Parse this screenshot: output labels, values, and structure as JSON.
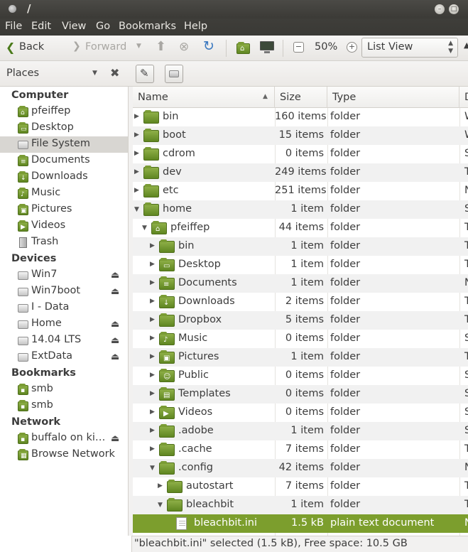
{
  "window": {
    "title": "/"
  },
  "menu": [
    "File",
    "Edit",
    "View",
    "Go",
    "Bookmarks",
    "Help"
  ],
  "toolbar": {
    "back": "Back",
    "forward": "Forward",
    "zoom": "50%",
    "view_mode": "List View"
  },
  "sidebar": {
    "header": "Places",
    "groups": [
      {
        "label": "Computer",
        "items": [
          {
            "label": "pfeiffep",
            "icon": "home-folder-icon"
          },
          {
            "label": "Desktop",
            "icon": "desktop-icon"
          },
          {
            "label": "File System",
            "icon": "drive-icon",
            "selected": true
          },
          {
            "label": "Documents",
            "icon": "documents-icon"
          },
          {
            "label": "Downloads",
            "icon": "downloads-icon"
          },
          {
            "label": "Music",
            "icon": "music-icon"
          },
          {
            "label": "Pictures",
            "icon": "pictures-icon"
          },
          {
            "label": "Videos",
            "icon": "videos-icon"
          },
          {
            "label": "Trash",
            "icon": "trash-icon"
          }
        ]
      },
      {
        "label": "Devices",
        "items": [
          {
            "label": "Win7",
            "icon": "drive-icon",
            "eject": true
          },
          {
            "label": "Win7boot",
            "icon": "drive-icon",
            "eject": true
          },
          {
            "label": "I - Data",
            "icon": "drive-icon"
          },
          {
            "label": "Home",
            "icon": "drive-icon",
            "eject": true
          },
          {
            "label": "14.04 LTS",
            "icon": "drive-icon",
            "eject": true
          },
          {
            "label": "ExtData",
            "icon": "drive-icon",
            "eject": true
          }
        ]
      },
      {
        "label": "Bookmarks",
        "items": [
          {
            "label": "smb",
            "icon": "network-folder-icon"
          },
          {
            "label": "smb",
            "icon": "network-folder-icon"
          }
        ]
      },
      {
        "label": "Network",
        "items": [
          {
            "label": "buffalo on ki…",
            "icon": "network-folder-icon",
            "eject": true
          },
          {
            "label": "Browse Network",
            "icon": "network-icon"
          }
        ]
      }
    ]
  },
  "columns": {
    "name": "Name",
    "size": "Size",
    "type": "Type",
    "date": "D"
  },
  "rows": [
    {
      "depth": 0,
      "expander": "collapsed",
      "name": "bin",
      "size": "160 items",
      "type": "folder",
      "date": "W",
      "icon": "folder-icon"
    },
    {
      "depth": 0,
      "expander": "collapsed",
      "name": "boot",
      "size": "15 items",
      "type": "folder",
      "date": "W",
      "icon": "folder-icon"
    },
    {
      "depth": 0,
      "expander": "collapsed",
      "name": "cdrom",
      "size": "0 items",
      "type": "folder",
      "date": "S",
      "icon": "folder-icon"
    },
    {
      "depth": 0,
      "expander": "collapsed",
      "name": "dev",
      "size": "249 items",
      "type": "folder",
      "date": "T",
      "icon": "folder-icon"
    },
    {
      "depth": 0,
      "expander": "collapsed",
      "name": "etc",
      "size": "251 items",
      "type": "folder",
      "date": "N",
      "icon": "folder-icon"
    },
    {
      "depth": 0,
      "expander": "expanded",
      "name": "home",
      "size": "1 item",
      "type": "folder",
      "date": "S",
      "icon": "folder-icon"
    },
    {
      "depth": 1,
      "expander": "expanded",
      "name": "pfeiffep",
      "size": "44 items",
      "type": "folder",
      "date": "T",
      "icon": "home-folder-icon"
    },
    {
      "depth": 2,
      "expander": "collapsed",
      "name": "bin",
      "size": "1 item",
      "type": "folder",
      "date": "T",
      "icon": "folder-icon"
    },
    {
      "depth": 2,
      "expander": "collapsed",
      "name": "Desktop",
      "size": "1 item",
      "type": "folder",
      "date": "T",
      "icon": "desktop-folder-icon"
    },
    {
      "depth": 2,
      "expander": "collapsed",
      "name": "Documents",
      "size": "1 item",
      "type": "folder",
      "date": "N",
      "icon": "documents-folder-icon"
    },
    {
      "depth": 2,
      "expander": "collapsed",
      "name": "Downloads",
      "size": "2 items",
      "type": "folder",
      "date": "T",
      "icon": "downloads-folder-icon"
    },
    {
      "depth": 2,
      "expander": "collapsed",
      "name": "Dropbox",
      "size": "5 items",
      "type": "folder",
      "date": "T",
      "icon": "folder-icon"
    },
    {
      "depth": 2,
      "expander": "collapsed",
      "name": "Music",
      "size": "0 items",
      "type": "folder",
      "date": "S",
      "icon": "music-folder-icon"
    },
    {
      "depth": 2,
      "expander": "collapsed",
      "name": "Pictures",
      "size": "1 item",
      "type": "folder",
      "date": "T",
      "icon": "pictures-folder-icon"
    },
    {
      "depth": 2,
      "expander": "collapsed",
      "name": "Public",
      "size": "0 items",
      "type": "folder",
      "date": "S",
      "icon": "public-folder-icon"
    },
    {
      "depth": 2,
      "expander": "collapsed",
      "name": "Templates",
      "size": "0 items",
      "type": "folder",
      "date": "S",
      "icon": "templates-folder-icon"
    },
    {
      "depth": 2,
      "expander": "collapsed",
      "name": "Videos",
      "size": "0 items",
      "type": "folder",
      "date": "S",
      "icon": "videos-folder-icon"
    },
    {
      "depth": 2,
      "expander": "collapsed",
      "name": ".adobe",
      "size": "1 item",
      "type": "folder",
      "date": "S",
      "icon": "folder-icon"
    },
    {
      "depth": 2,
      "expander": "collapsed",
      "name": ".cache",
      "size": "7 items",
      "type": "folder",
      "date": "T",
      "icon": "folder-icon"
    },
    {
      "depth": 2,
      "expander": "expanded",
      "name": ".config",
      "size": "42 items",
      "type": "folder",
      "date": "N",
      "icon": "folder-icon"
    },
    {
      "depth": 3,
      "expander": "collapsed",
      "name": "autostart",
      "size": "7 items",
      "type": "folder",
      "date": "T",
      "icon": "folder-icon"
    },
    {
      "depth": 3,
      "expander": "expanded",
      "name": "bleachbit",
      "size": "1 item",
      "type": "folder",
      "date": "T",
      "icon": "folder-icon"
    },
    {
      "depth": 4,
      "expander": "none",
      "name": "bleachbit.ini",
      "size": "1.5 kB",
      "type": "plain text document",
      "date": "N",
      "icon": "text-file-icon",
      "selected": true
    }
  ],
  "status": "\"bleachbit.ini\" selected (1.5 kB), Free space: 10.5 GB",
  "colors": {
    "accent": "#7c9e2d",
    "titlebar": "#3f3e3a",
    "folder": "#6f9430"
  }
}
